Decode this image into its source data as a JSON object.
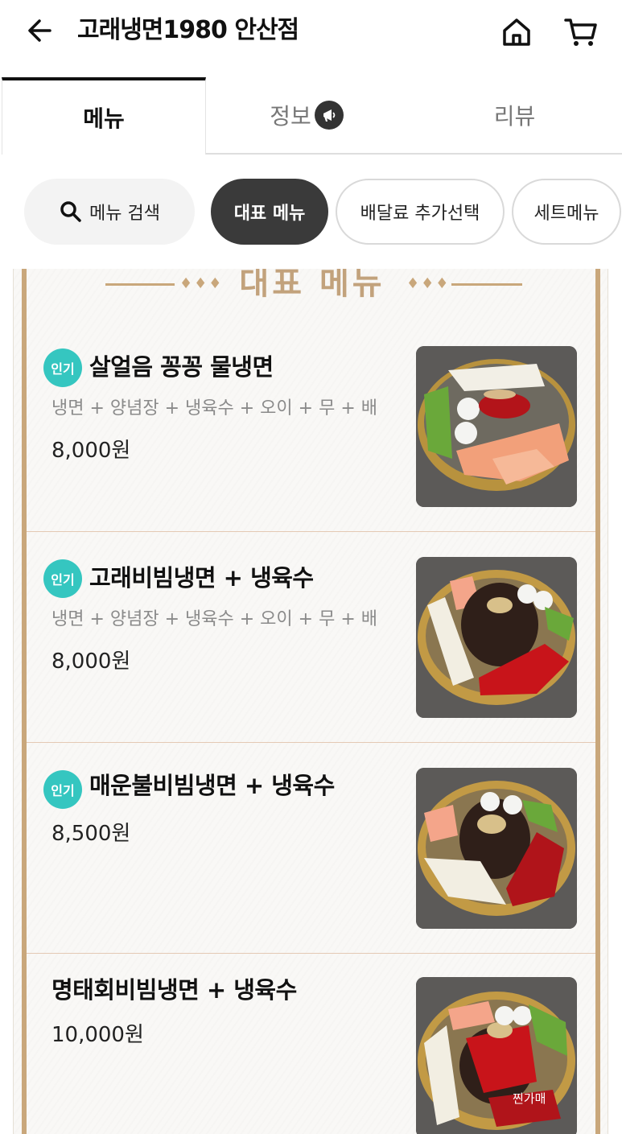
{
  "header": {
    "title": "고래냉면1980 안산점",
    "icons": [
      "back-arrow-icon",
      "home-icon",
      "cart-icon"
    ]
  },
  "tabs": [
    {
      "label": "메뉴",
      "active": true
    },
    {
      "label": "정보",
      "active": false,
      "icon": "megaphone-icon"
    },
    {
      "label": "리뷰",
      "active": false
    }
  ],
  "chips": {
    "search_label": "메뉴 검색",
    "items": [
      {
        "label": "대표 메뉴",
        "active": true
      },
      {
        "label": "배달료 추가선택",
        "active": false
      },
      {
        "label": "세트메뉴",
        "active": false
      }
    ]
  },
  "section": {
    "title": "대표 메뉴",
    "colors": {
      "frame": "#c9a77b",
      "badge": "#35c6c0"
    }
  },
  "menu_items": [
    {
      "name": "살얼음 꽁꽁 물냉면",
      "badge": "인기",
      "description": "냉면 + 양념장 + 냉육수 + 오이 + 무 + 배",
      "price": "8,000원"
    },
    {
      "name": "고래비빔냉면 + 냉육수",
      "badge": "인기",
      "description": "냉면 + 양념장 + 냉육수 + 오이 + 무 + 배",
      "price": "8,000원"
    },
    {
      "name": "매운불비빔냉면 + 냉육수",
      "badge": "인기",
      "price": "8,500원"
    },
    {
      "name": "명태회비빔냉면 + 냉육수",
      "price": "10,000원",
      "photo_watermark": "찐가매"
    }
  ]
}
